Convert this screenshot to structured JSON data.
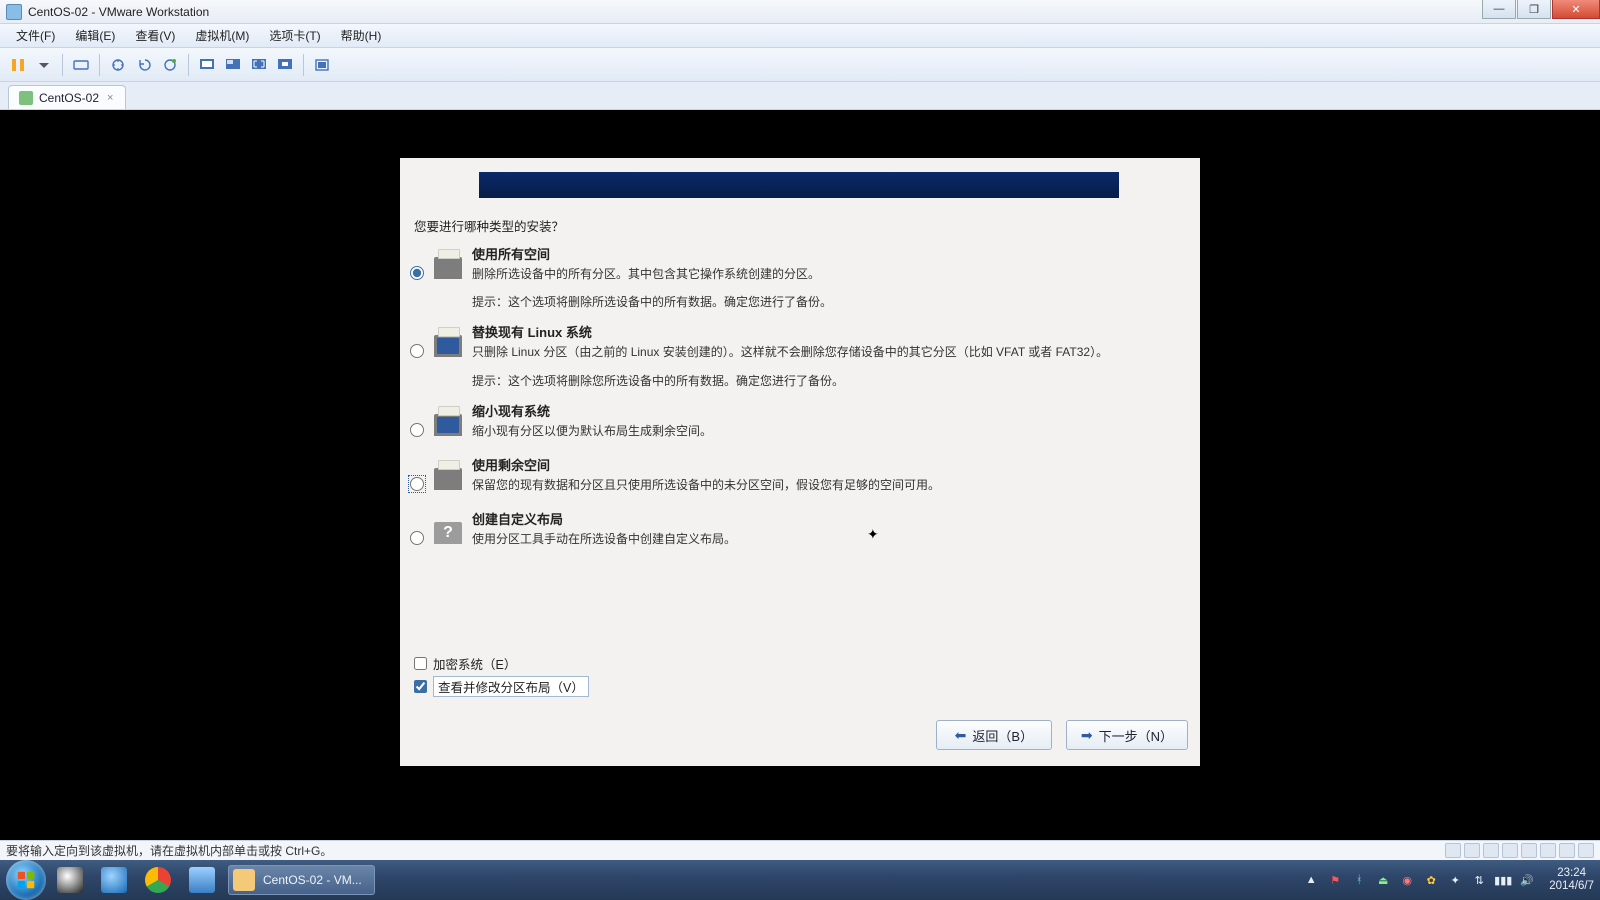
{
  "window": {
    "title": "CentOS-02 - VMware Workstation",
    "controls": {
      "min": "—",
      "max": "❐",
      "close": "✕"
    }
  },
  "menu": {
    "file": "文件(F)",
    "edit": "编辑(E)",
    "view": "查看(V)",
    "vm": "虚拟机(M)",
    "tabs": "选项卡(T)",
    "help": "帮助(H)"
  },
  "tab": {
    "label": "CentOS-02",
    "close": "×"
  },
  "installer": {
    "prompt": "您要进行哪种类型的安装？",
    "options": [
      {
        "id": "use-all",
        "title": "使用所有空间",
        "desc": "删除所选设备中的所有分区。其中包含其它操作系统创建的分区。",
        "hint": "提示：这个选项将删除所选设备中的所有数据。确定您进行了备份。",
        "selected": true,
        "hover": false,
        "icon": "plain"
      },
      {
        "id": "replace-linux",
        "title": "替换现有 Linux 系统",
        "desc": "只删除 Linux 分区（由之前的 Linux 安装创建的）。这样就不会删除您存储设备中的其它分区（比如 VFAT 或者 FAT32）。",
        "hint": "提示：这个选项将删除您所选设备中的所有数据。确定您进行了备份。",
        "selected": false,
        "hover": false,
        "icon": "blue"
      },
      {
        "id": "shrink",
        "title": "缩小现有系统",
        "desc": "缩小现有分区以便为默认布局生成剩余空间。",
        "hint": "",
        "selected": false,
        "hover": false,
        "icon": "blue"
      },
      {
        "id": "use-free",
        "title": "使用剩余空间",
        "desc": "保留您的现有数据和分区且只使用所选设备中的未分区空间，假设您有足够的空间可用。",
        "hint": "",
        "selected": false,
        "hover": true,
        "icon": "plain"
      },
      {
        "id": "custom",
        "title": "创建自定义布局",
        "desc": "使用分区工具手动在所选设备中创建自定义布局。",
        "hint": "",
        "selected": false,
        "hover": false,
        "icon": "q"
      }
    ],
    "encrypt": {
      "label": "加密系统（E）",
      "checked": false
    },
    "review": {
      "label": "查看并修改分区布局（V）",
      "checked": true
    },
    "back_label": "返回（B）",
    "next_label": "下一步（N）"
  },
  "host_status": "要将输入定向到该虚拟机，请在虚拟机内部单击或按 Ctrl+G。",
  "taskbar": {
    "task_label": "CentOS-02 - VM...",
    "clock_time": "23:24",
    "clock_date": "2014/6/7"
  }
}
